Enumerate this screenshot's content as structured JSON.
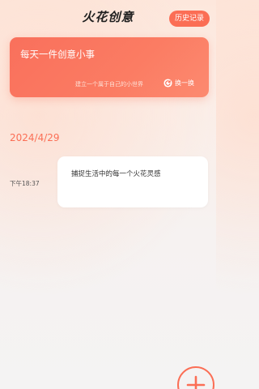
{
  "header": {
    "title": "火花创意",
    "history_button": "历史记录"
  },
  "hero": {
    "title": "每天一件创意小事",
    "subtitle": "建立一个属于自己的小世界",
    "refresh_icon": "refresh-icon",
    "refresh_label": "换一换"
  },
  "entries": {
    "date": "2024/4/29",
    "items": [
      {
        "time": "下午18:37",
        "text": "捕捉生活中的每一个火花灵感"
      }
    ]
  },
  "fab": {
    "icon": "plus-icon"
  },
  "colors": {
    "accent": "#fb6e55",
    "card": "#ffffff",
    "background": "#f4f3f3"
  }
}
